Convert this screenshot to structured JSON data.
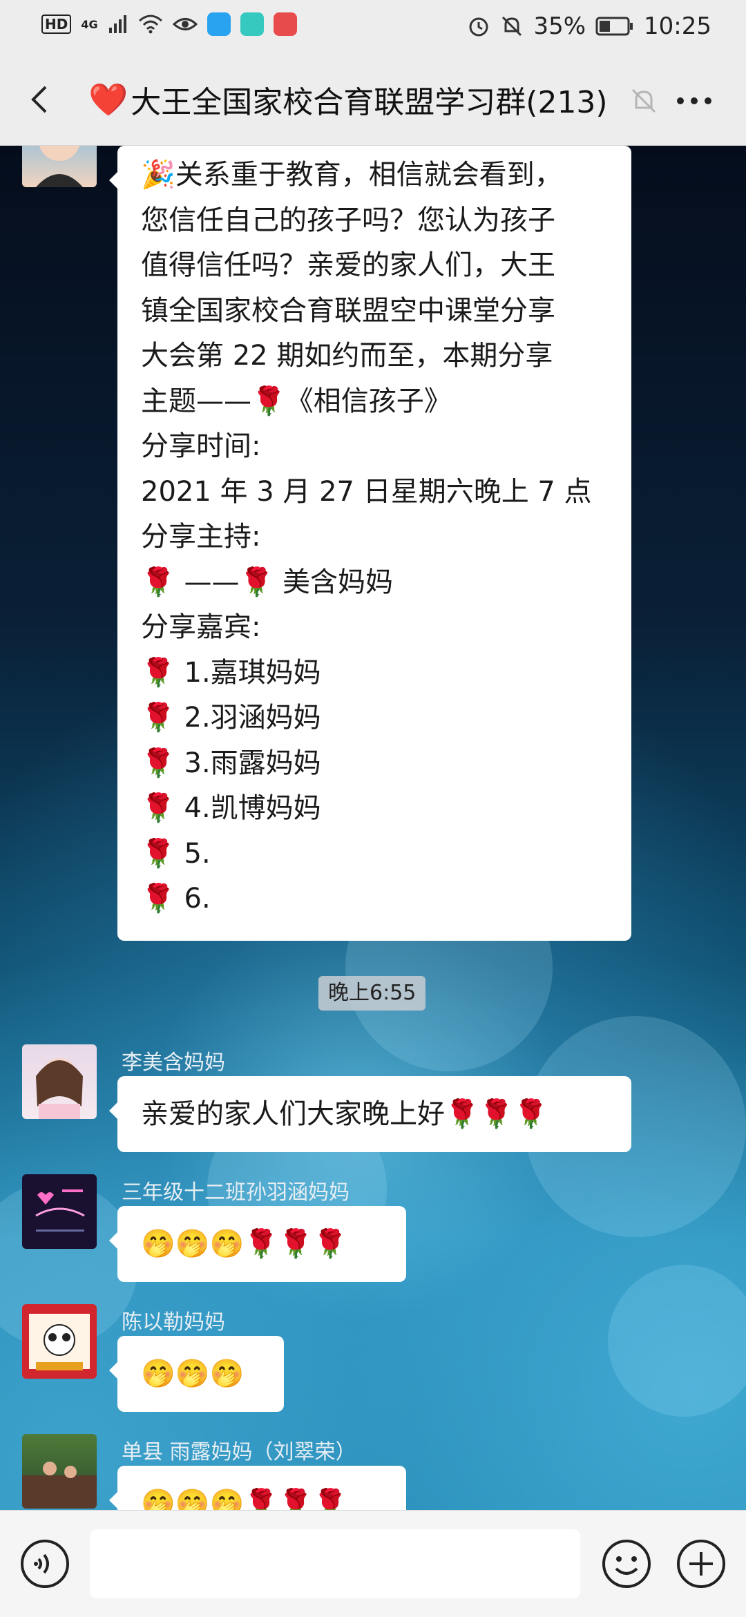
{
  "status_bar": {
    "hd": "HD",
    "network": "4G",
    "battery": "35%",
    "time": "10:25"
  },
  "header": {
    "heart": "❤️",
    "title": "大王全国家校合育联盟学习群(213)"
  },
  "messages": [
    {
      "lines": [
        "🎉关系重于教育，相信就会看到，",
        "您信任自己的孩子吗？您认为孩子",
        "值得信任吗？亲爱的家人们，大王",
        "镇全国家校合育联盟空中课堂分享",
        "大会第 22 期如约而至，本期分享",
        "主题——🌹《相信孩子》",
        "分享时间:",
        "2021 年 3 月 27 日星期六晚上 7 点",
        "分享主持:",
        "🌹 ——🌹 美含妈妈",
        "分享嘉宾:",
        "🌹 1.嘉琪妈妈",
        "🌹 2.羽涵妈妈",
        "🌹 3.雨露妈妈",
        "🌹 4.凯博妈妈",
        "🌹 5.",
        "🌹 6."
      ]
    }
  ],
  "timestamp": "晚上6:55",
  "chat": [
    {
      "sender": "李美含妈妈",
      "text": "亲爱的家人们大家晚上好🌹🌹🌹"
    },
    {
      "sender": "三年级十二班孙羽涵妈妈",
      "text": "🤭🤭🤭🌹🌹🌹"
    },
    {
      "sender": "陈以勒妈妈",
      "text": "🤭🤭🤭"
    },
    {
      "sender": "单县 雨露妈妈（刘翠荣）",
      "text": "🤭🤭🤭🌹🌹🌹"
    }
  ]
}
